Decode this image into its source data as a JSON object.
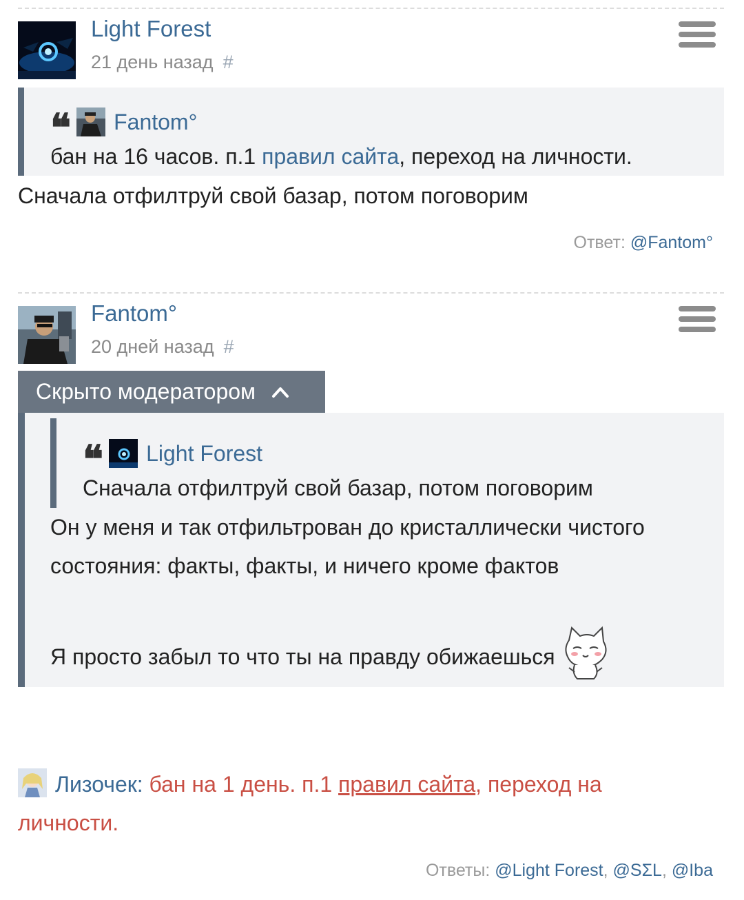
{
  "comment1": {
    "username": "Light Forest",
    "timestamp": "21 день назад",
    "hash": "#",
    "quote": {
      "author": "Fantom°",
      "text_before": "бан на 16 часов. п.1 ",
      "link": "правил сайта",
      "text_after": ", переход на личности."
    },
    "body": "Сначала отфилтруй свой базар, потом поговорим",
    "reply_label": "Ответ:",
    "reply_to": "@Fantom°"
  },
  "comment2": {
    "username": "Fantom°",
    "timestamp": "20 дней назад",
    "hash": "#",
    "hidden_label": "Скрыто модератором",
    "quote": {
      "author": "Light Forest",
      "text": "Сначала отфилтруй свой базар, потом поговорим"
    },
    "body_line1": "Он у меня и так отфильтрован до кристаллически чистого",
    "body_line2": "состояния: факты, факты, и ничего кроме фактов",
    "body_line3": "Я просто забыл то что ты на правду обижаешься"
  },
  "moderation": {
    "moderator": "Лизочек",
    "colon": ":",
    "text_before": " бан на 1 день. п.1 ",
    "link": "правил сайта",
    "text_after": ", переход на",
    "text_line2": "личности.",
    "replies_label": "Ответы:",
    "replies": [
      "@Light Forest",
      "@SΣL",
      "@Iba"
    ]
  },
  "icons": {
    "menu": "hamburger-menu-icon",
    "collapse": "chevron-up-icon",
    "quote": "quote-icon",
    "emoji": "cat-emoji-icon"
  },
  "colors": {
    "link": "#3b6a95",
    "moderation": "#c94f44",
    "quote_bar": "#5b6b7c",
    "hidden_bar": "#6a7582"
  }
}
